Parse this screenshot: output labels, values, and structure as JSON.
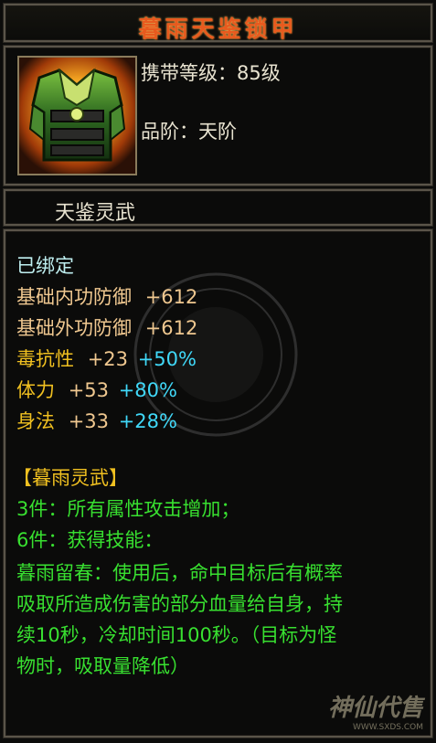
{
  "item": {
    "name": "暮雨天鉴锁甲",
    "level_line": "携带等级：85级",
    "grade_line": "品阶：天阶",
    "set_title": "天鉴灵武"
  },
  "details": {
    "bound": "已绑定",
    "base_stats": [
      {
        "label": "基础内功防御",
        "value": "+612"
      },
      {
        "label": "基础外功防御",
        "value": "+612"
      }
    ],
    "attributes": [
      {
        "label": "毒抗性",
        "value": "+23",
        "bonus": "+50%"
      },
      {
        "label": "体力",
        "value": "+53",
        "bonus": "+80%"
      },
      {
        "label": "身法",
        "value": "+33",
        "bonus": "+28%"
      }
    ],
    "set_name": "【暮雨灵武】",
    "set_bonus_lines": [
      "3件：所有属性攻击增加；",
      "6件：获得技能：",
      "暮雨留春：使用后，命中目标后有概率",
      "吸取所造成伤害的部分血量给自身，持",
      "续10秒，冷却时间100秒。（目标为怪",
      "物时，吸取量降低）"
    ]
  },
  "watermark": {
    "text": "神仙代售",
    "url": "WWW.SXDS.COM"
  },
  "colors": {
    "title": "#e85a1e",
    "bound": "#bfeff0",
    "base": "#f0c890",
    "attr": "#f0c020",
    "bonus": "#40d8f8",
    "set_name": "#f0c020",
    "set_text": "#38e030"
  }
}
